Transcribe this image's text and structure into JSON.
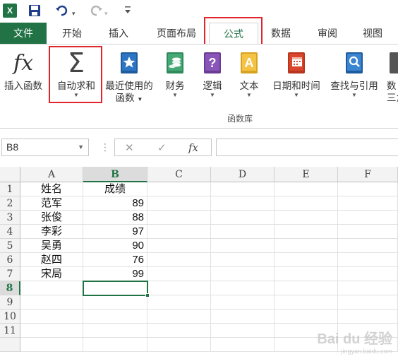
{
  "qat": {
    "logo": "X",
    "save_icon": "save-icon",
    "undo_icon": "undo-icon",
    "redo_icon": "redo-icon",
    "customize_icon": "customize-icon"
  },
  "tabs": [
    {
      "label": "文件"
    },
    {
      "label": "开始"
    },
    {
      "label": "插入"
    },
    {
      "label": "页面布局"
    },
    {
      "label": "公式"
    },
    {
      "label": "数据"
    },
    {
      "label": "审阅"
    },
    {
      "label": "视图"
    }
  ],
  "ribbon": {
    "insert_function": {
      "label": "插入函数",
      "icon": "fx-icon",
      "glyph": "fx"
    },
    "autosum": {
      "label": "自动求和",
      "icon": "sigma-icon",
      "glyph": "Σ"
    },
    "recent": {
      "label1": "最近使用的",
      "label2": "函数",
      "icon": "star-book-icon"
    },
    "financial": {
      "label": "财务",
      "icon": "finance-book-icon"
    },
    "logical": {
      "label": "逻辑",
      "icon": "question-book-icon",
      "glyph": "?"
    },
    "text": {
      "label": "文本",
      "icon": "text-book-icon",
      "glyph": "A"
    },
    "datetime": {
      "label": "日期和时间",
      "icon": "calendar-book-icon"
    },
    "lookup": {
      "label": "查找与引用",
      "icon": "search-book-icon"
    },
    "math_partial": {
      "label1": "数",
      "label2": "三角"
    },
    "group_label": "函数库"
  },
  "formula_bar": {
    "name_box": "B8",
    "cancel_glyph": "✕",
    "enter_glyph": "✓",
    "fx_glyph": "fx",
    "formula": ""
  },
  "sheet": {
    "columns": [
      "A",
      "B",
      "C",
      "D",
      "E",
      "F"
    ],
    "rows": [
      "1",
      "2",
      "3",
      "4",
      "5",
      "6",
      "7",
      "8",
      "9",
      "10",
      "11"
    ],
    "selected_column": "B",
    "selected_row": "8",
    "headers": {
      "name": "姓名",
      "score": "成绩"
    },
    "data": [
      {
        "name": "范军",
        "score": "89"
      },
      {
        "name": "张俊",
        "score": "88"
      },
      {
        "name": "李彩",
        "score": "97"
      },
      {
        "name": "吴勇",
        "score": "90"
      },
      {
        "name": "赵四",
        "score": "76"
      },
      {
        "name": "宋局",
        "score": "99"
      }
    ]
  },
  "watermark": {
    "text": "Bai du 经验",
    "sub": "jingyan.baidu.com"
  },
  "colors": {
    "excel_green": "#217346",
    "highlight_red": "#e0262a"
  }
}
